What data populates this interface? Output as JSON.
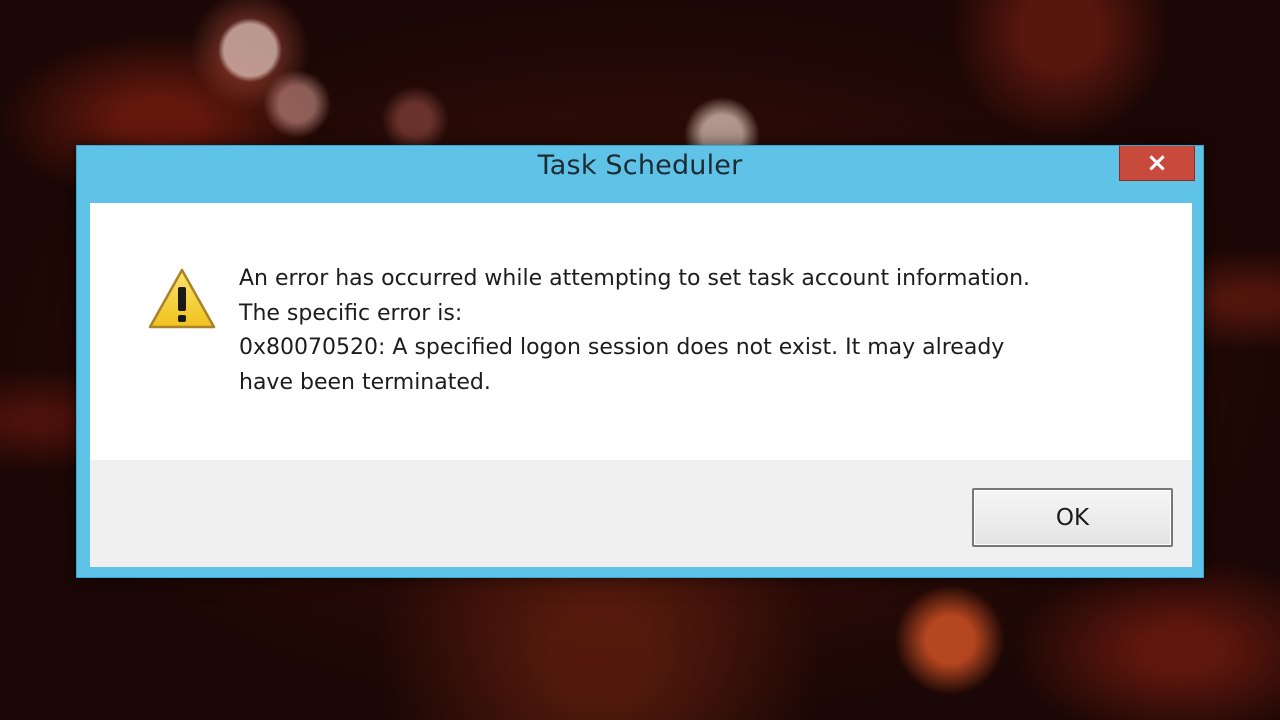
{
  "dialog": {
    "title": "Task Scheduler",
    "close_symbol": "×",
    "icon": "warning-icon",
    "message_lines": [
      "An error has occurred while attempting to set task account information.",
      "The specific error is:",
      "0x80070520: A specified logon session does not exist. It may already",
      "have been terminated."
    ],
    "ok_label": "OK"
  },
  "colors": {
    "frame": "#5ec3e6",
    "close_button": "#c84a3c",
    "warning_fill": "#f7d63a",
    "footer": "#f0f0f0"
  }
}
